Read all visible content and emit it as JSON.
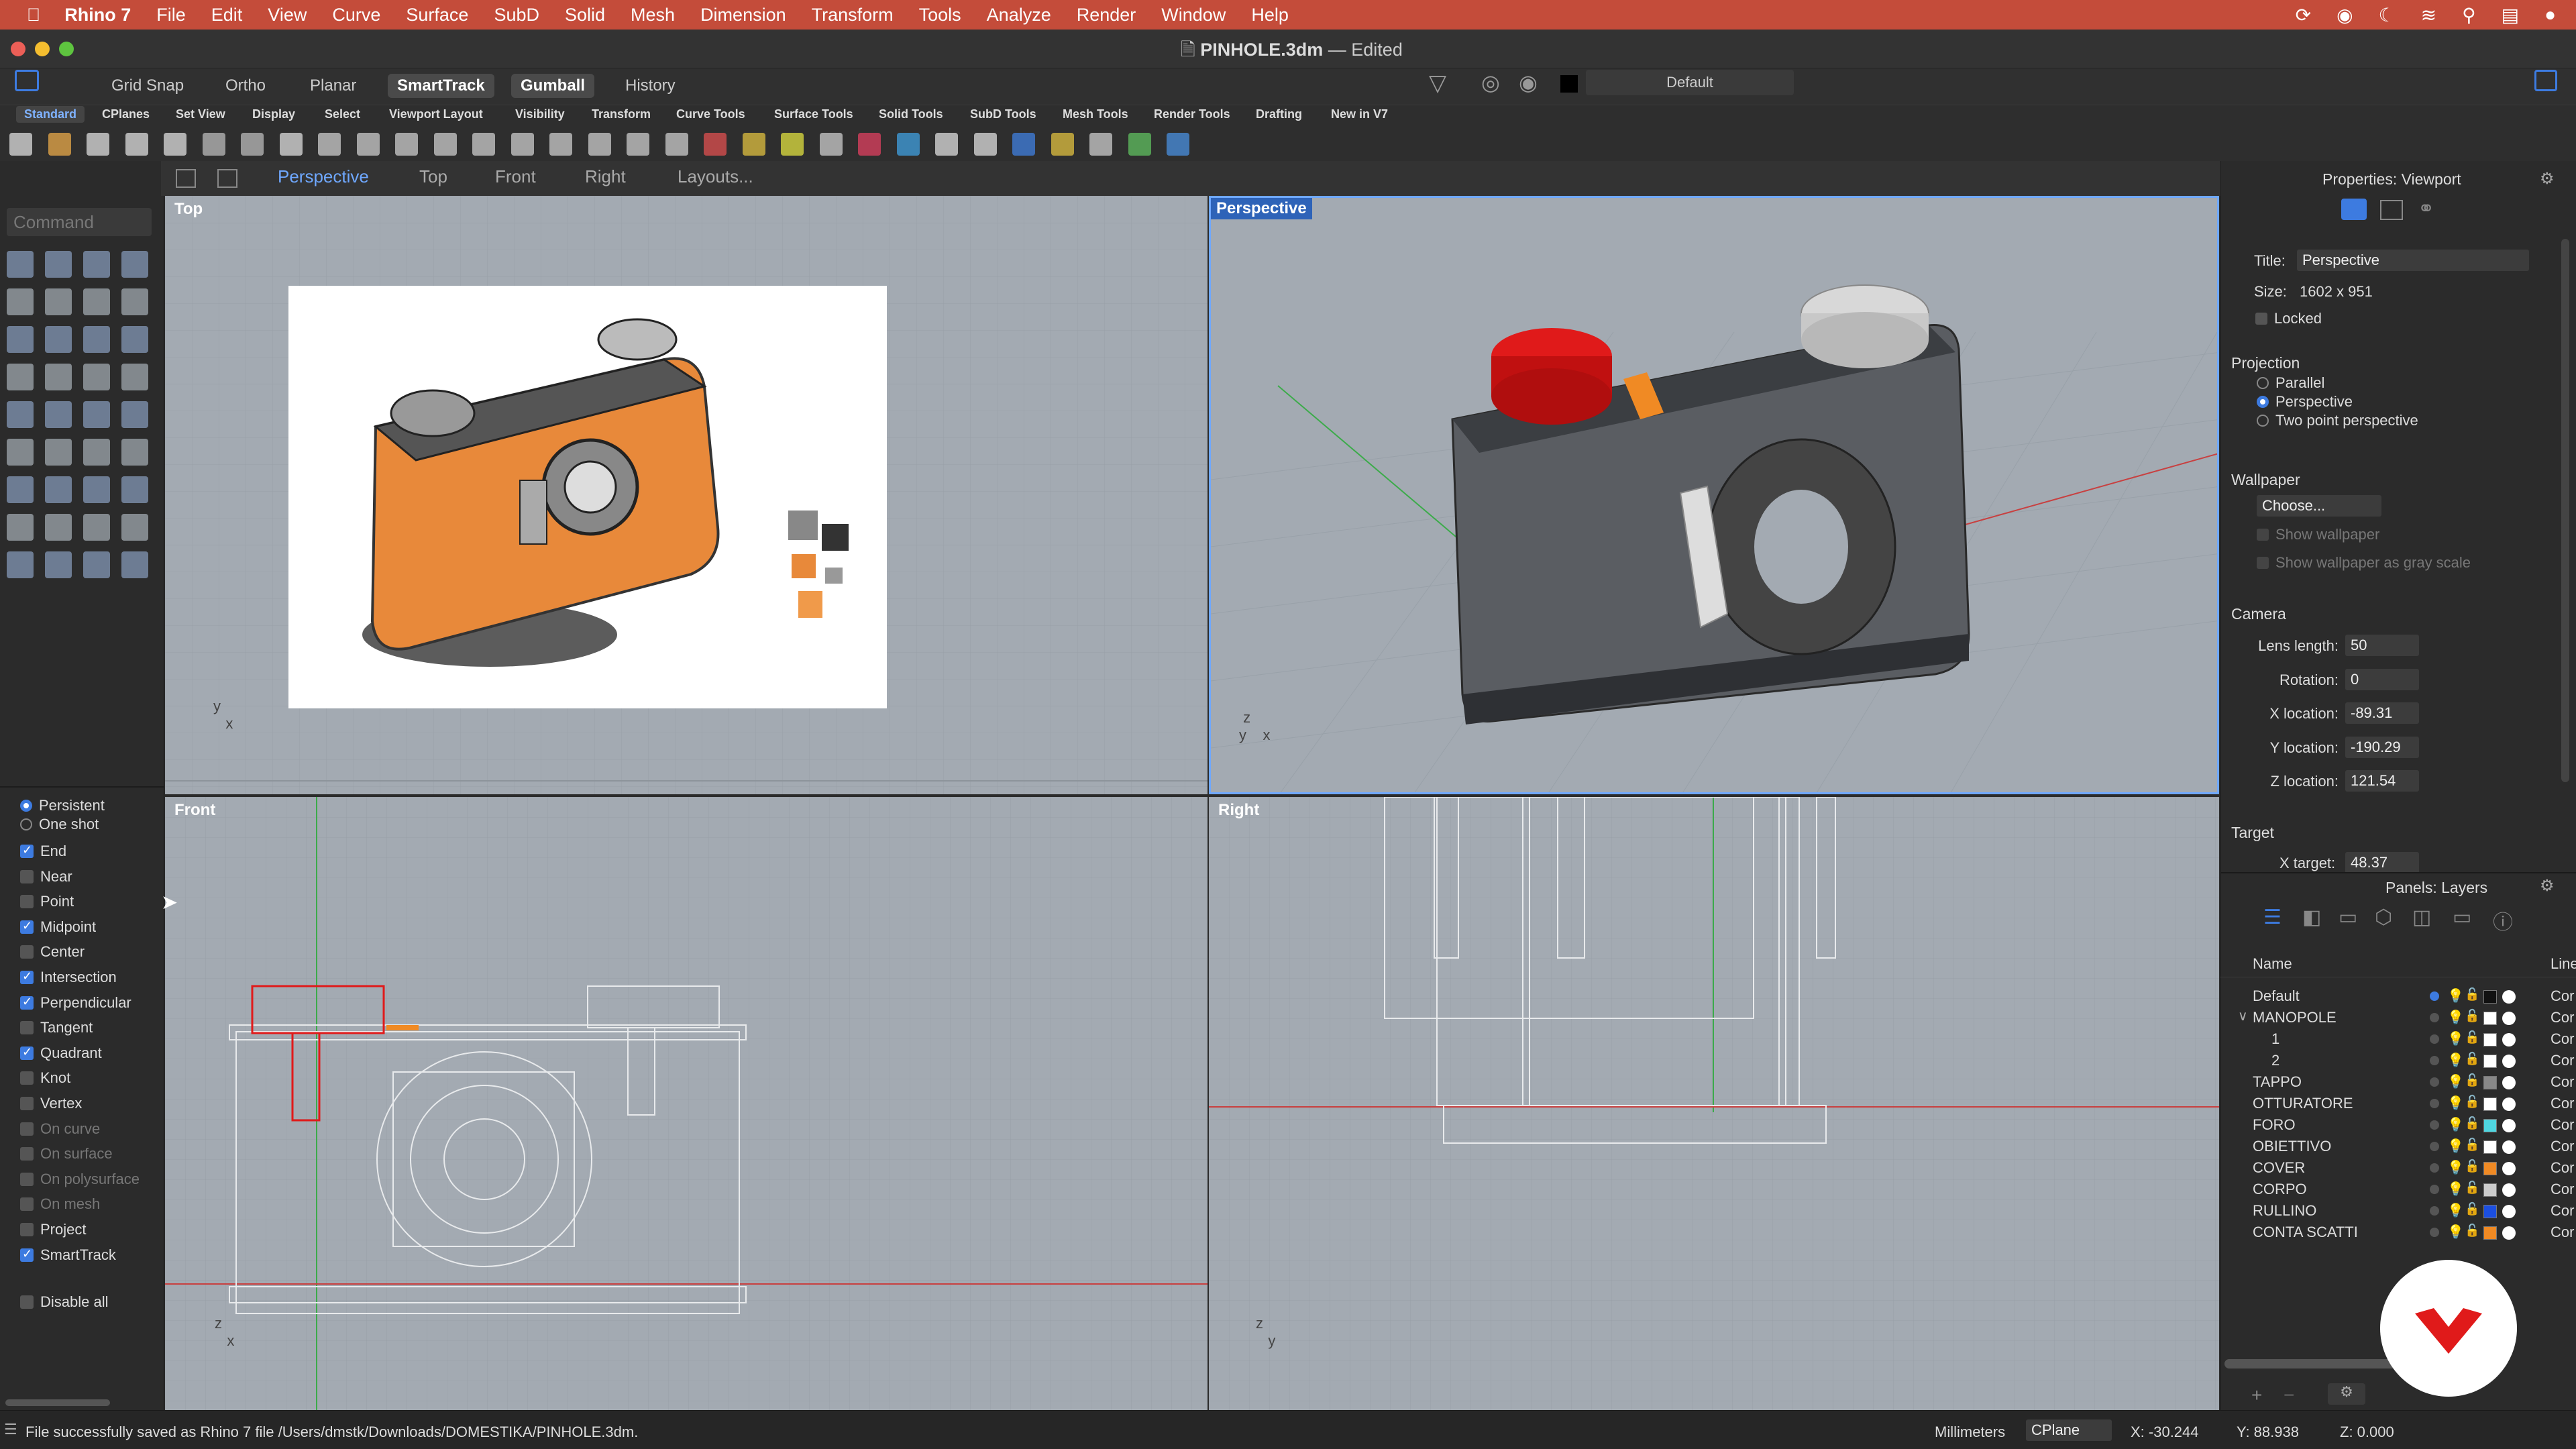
{
  "menubar": {
    "app": "Rhino 7",
    "items": [
      "File",
      "Edit",
      "View",
      "Curve",
      "Surface",
      "SubD",
      "Solid",
      "Mesh",
      "Dimension",
      "Transform",
      "Tools",
      "Analyze",
      "Render",
      "Window",
      "Help"
    ]
  },
  "titlebar": {
    "filename": "PINHOLE.3dm",
    "state": "— Edited"
  },
  "toolbar": {
    "toggles": [
      {
        "label": "Grid Snap",
        "on": false
      },
      {
        "label": "Ortho",
        "on": false
      },
      {
        "label": "Planar",
        "on": false
      },
      {
        "label": "SmartTrack",
        "on": true
      },
      {
        "label": "Gumball",
        "on": true
      },
      {
        "label": "History",
        "on": false
      }
    ],
    "layer_label": "Default"
  },
  "tabs": [
    "Standard",
    "CPlanes",
    "Set View",
    "Display",
    "Select",
    "Viewport Layout",
    "Visibility",
    "Transform",
    "Curve Tools",
    "Surface Tools",
    "Solid Tools",
    "SubD Tools",
    "Mesh Tools",
    "Render Tools",
    "Drafting",
    "New in V7"
  ],
  "viewport_tabs": [
    {
      "label": "Perspective",
      "active": true
    },
    {
      "label": "Top",
      "active": false
    },
    {
      "label": "Front",
      "active": false
    },
    {
      "label": "Right",
      "active": false
    },
    {
      "label": "Layouts...",
      "active": false
    }
  ],
  "command": {
    "placeholder": "Command"
  },
  "osnap": {
    "modes": [
      {
        "label": "Persistent",
        "selected": true
      },
      {
        "label": "One shot",
        "selected": false
      }
    ],
    "items": [
      {
        "label": "End",
        "checked": true,
        "enabled": true
      },
      {
        "label": "Near",
        "checked": false,
        "enabled": true
      },
      {
        "label": "Point",
        "checked": false,
        "enabled": true
      },
      {
        "label": "Midpoint",
        "checked": true,
        "enabled": true
      },
      {
        "label": "Center",
        "checked": false,
        "enabled": true
      },
      {
        "label": "Intersection",
        "checked": true,
        "enabled": true
      },
      {
        "label": "Perpendicular",
        "checked": true,
        "enabled": true
      },
      {
        "label": "Tangent",
        "checked": false,
        "enabled": true
      },
      {
        "label": "Quadrant",
        "checked": true,
        "enabled": true
      },
      {
        "label": "Knot",
        "checked": false,
        "enabled": true
      },
      {
        "label": "Vertex",
        "checked": false,
        "enabled": true
      },
      {
        "label": "On curve",
        "checked": false,
        "enabled": false
      },
      {
        "label": "On surface",
        "checked": false,
        "enabled": false
      },
      {
        "label": "On polysurface",
        "checked": false,
        "enabled": false
      },
      {
        "label": "On mesh",
        "checked": false,
        "enabled": false
      },
      {
        "label": "Project",
        "checked": false,
        "enabled": true
      },
      {
        "label": "SmartTrack",
        "checked": true,
        "enabled": true
      }
    ],
    "disable_all": "Disable all"
  },
  "viewports": {
    "top": "Top",
    "perspective": "Perspective",
    "front": "Front",
    "right": "Right"
  },
  "properties": {
    "header": "Properties: Viewport",
    "title_label": "Title:",
    "title_value": "Perspective",
    "size_label": "Size:",
    "size_value": "1602 x 951",
    "locked": "Locked",
    "projection_head": "Projection",
    "projection": [
      {
        "label": "Parallel",
        "selected": false
      },
      {
        "label": "Perspective",
        "selected": true
      },
      {
        "label": "Two point perspective",
        "selected": false
      }
    ],
    "wallpaper_head": "Wallpaper",
    "wallpaper_choose": "Choose...",
    "show_wallpaper": "Show wallpaper",
    "show_gray": "Show wallpaper as gray scale",
    "camera_head": "Camera",
    "camera": [
      {
        "label": "Lens length:",
        "value": "50"
      },
      {
        "label": "Rotation:",
        "value": "0"
      },
      {
        "label": "X location:",
        "value": "-89.31"
      },
      {
        "label": "Y location:",
        "value": "-190.29"
      },
      {
        "label": "Z location:",
        "value": "121.54"
      }
    ],
    "target_head": "Target",
    "x_target_label": "X target:",
    "x_target_value": "48.37"
  },
  "layers": {
    "header": "Panels: Layers",
    "col_name": "Name",
    "col_line": "Line",
    "rows": [
      {
        "name": "Default",
        "indent": 0,
        "color": "#111111",
        "current": true
      },
      {
        "name": "MANOPOLE",
        "indent": 0,
        "color": "#ffffff",
        "expanded": true
      },
      {
        "name": "1",
        "indent": 2,
        "color": "#ffffff"
      },
      {
        "name": "2",
        "indent": 2,
        "color": "#ffffff"
      },
      {
        "name": "TAPPO",
        "indent": 0,
        "color": "#888888"
      },
      {
        "name": "OTTURATORE",
        "indent": 0,
        "color": "#ffffff"
      },
      {
        "name": "FORO",
        "indent": 0,
        "color": "#4fd6e0"
      },
      {
        "name": "OBIETTIVO",
        "indent": 0,
        "color": "#ffffff"
      },
      {
        "name": "COVER",
        "indent": 0,
        "color": "#f08a24"
      },
      {
        "name": "CORPO",
        "indent": 0,
        "color": "#cccccc"
      },
      {
        "name": "RULLINO",
        "indent": 0,
        "color": "#1c4fe0"
      },
      {
        "name": "CONTA SCATTI",
        "indent": 0,
        "color": "#f08a24"
      }
    ],
    "line_value": "Cor"
  },
  "status": {
    "message": "File successfully saved as Rhino 7 file /Users/dmstk/Downloads/DOMESTIKA/PINHOLE.3dm.",
    "units": "Millimeters",
    "cplane": "CPlane",
    "x": "X: -30.244",
    "y": "Y: 88.938",
    "z": "Z: 0.000"
  },
  "colors": {
    "menubar": "#c44c3a",
    "accent": "#3d7be0",
    "viewport_bg": "#a3aab2",
    "red_part": "#e01a1a",
    "orange_part": "#f08a24"
  }
}
